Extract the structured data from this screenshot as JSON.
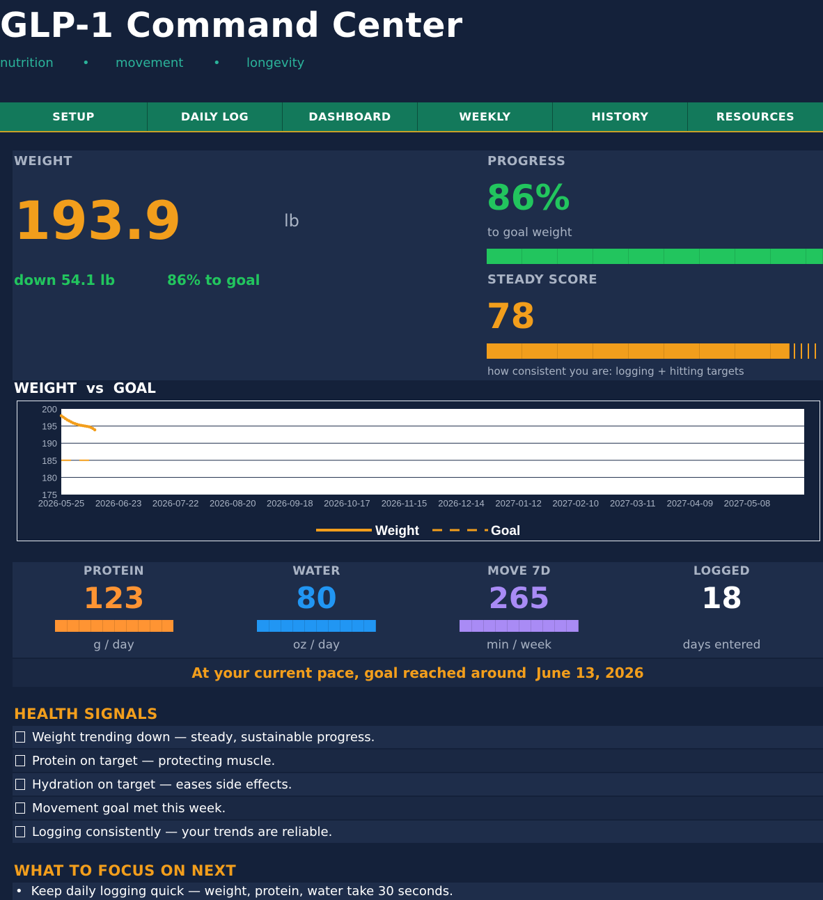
{
  "header": {
    "title": "GLP-1 Command Center",
    "subtitle_items": [
      "nutrition",
      "movement",
      "longevity"
    ],
    "separator": "•"
  },
  "nav": {
    "tabs": [
      "SETUP",
      "DAILY LOG",
      "DASHBOARD",
      "WEEKLY",
      "HISTORY",
      "RESOURCES"
    ]
  },
  "weight_card": {
    "label": "WEIGHT",
    "value": "193.9",
    "unit": "lb",
    "change": "down 54.1 lb",
    "to_goal": "86% to goal"
  },
  "progress_card": {
    "label": "PROGRESS",
    "value": "86%",
    "caption": "to goal weight",
    "fraction": 0.86
  },
  "steady_card": {
    "label": "STEADY SCORE",
    "value": "78",
    "caption": "how consistent you are: logging + hitting targets",
    "fraction": 0.78
  },
  "chart_section": {
    "title_part1": "WEIGHT",
    "title_vs": "vs",
    "title_part2": "GOAL"
  },
  "chart_data": {
    "type": "line",
    "y_ticks": [
      200,
      195,
      190,
      185,
      180,
      175
    ],
    "ylim": [
      175,
      200
    ],
    "x_ticks": [
      "2026-05-25",
      "2026-06-23",
      "2026-07-22",
      "2026-08-20",
      "2026-09-18",
      "2026-10-17",
      "2026-11-15",
      "2026-12-14",
      "2027-01-12",
      "2027-02-10",
      "2027-03-11",
      "2027-04-09",
      "2027-05-08"
    ],
    "xlim": [
      "2026-05-25",
      "2027-06-06"
    ],
    "grid": true,
    "legend": "bottom",
    "series": [
      {
        "name": "Weight",
        "style": "solid",
        "color": "#f29e1c",
        "x": [
          "2026-05-25",
          "2026-05-26",
          "2026-05-27",
          "2026-05-28",
          "2026-05-29",
          "2026-05-30",
          "2026-05-31",
          "2026-06-01",
          "2026-06-02",
          "2026-06-03",
          "2026-06-04",
          "2026-06-05",
          "2026-06-06",
          "2026-06-07",
          "2026-06-08",
          "2026-06-09",
          "2026-06-10",
          "2026-06-11"
        ],
        "values": [
          198.0,
          197.6,
          197.2,
          196.8,
          196.5,
          196.2,
          195.9,
          195.7,
          195.5,
          195.3,
          195.2,
          195.1,
          195.0,
          194.9,
          194.8,
          194.6,
          194.3,
          193.9
        ]
      },
      {
        "name": "Goal",
        "style": "dashed",
        "color": "#f29e1c",
        "x": [
          "2026-05-25",
          "2026-06-11"
        ],
        "values": [
          185,
          185
        ]
      }
    ]
  },
  "metrics": [
    {
      "label": "PROTEIN",
      "value": "123",
      "unit": "g / day",
      "color": "#ff9433"
    },
    {
      "label": "WATER",
      "value": "80",
      "unit": "oz / day",
      "color": "#2196f3"
    },
    {
      "label": "MOVE 7D",
      "value": "265",
      "unit": "min / week",
      "color": "#a98bf5"
    },
    {
      "label": "LOGGED",
      "value": "18",
      "unit": "days entered",
      "color": "#ffffff"
    }
  ],
  "pace": {
    "text": "At your current pace, goal reached around  June 13, 2026"
  },
  "health_signals": {
    "heading": "HEALTH SIGNALS",
    "items": [
      "Weight trending down — steady, sustainable progress.",
      "Protein on target — protecting muscle.",
      "Hydration on target — eases side effects.",
      "Movement goal met this week.",
      "Logging consistently — your trends are reliable."
    ]
  },
  "focus": {
    "heading": "WHAT TO FOCUS ON NEXT",
    "bullet": "•",
    "items": [
      "Keep daily logging quick — weight, protein, water take 30 seconds."
    ]
  }
}
